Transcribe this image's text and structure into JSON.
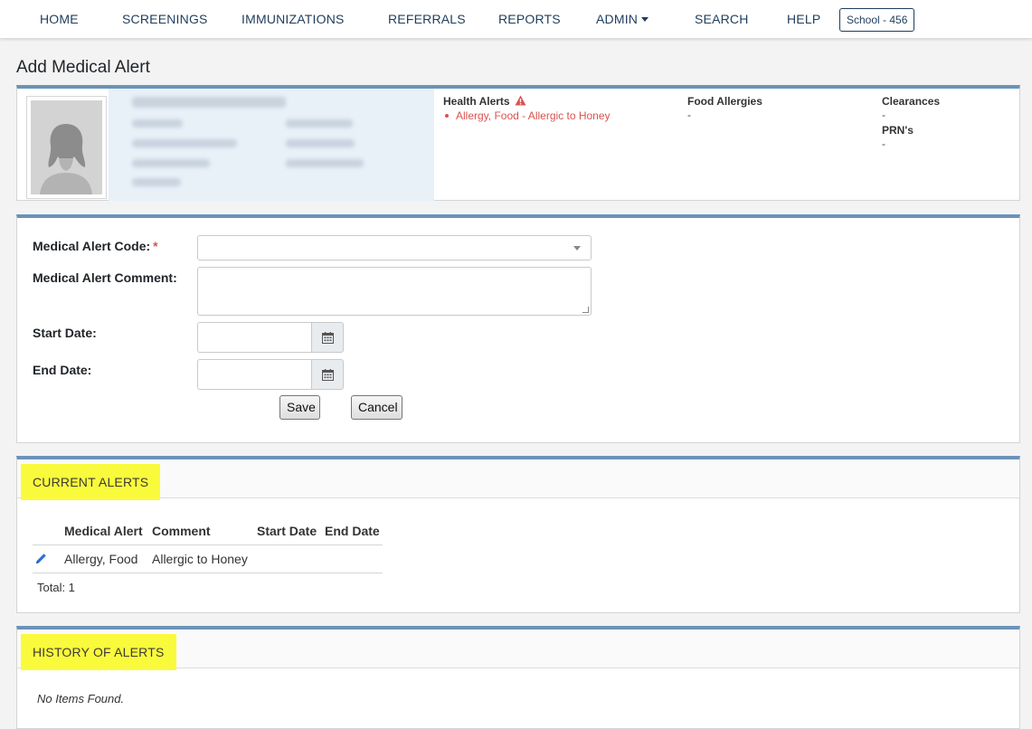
{
  "nav": {
    "items": [
      "HOME",
      "SCREENINGS",
      "IMMUNIZATIONS",
      "REFERRALS",
      "REPORTS",
      "ADMIN",
      "SEARCH",
      "HELP"
    ],
    "school_badge": "School - 456"
  },
  "page_title": "Add Medical Alert",
  "student": {
    "health_alerts_heading": "Health Alerts",
    "health_alert_item": "Allergy, Food - Allergic to Honey",
    "food_allergies_heading": "Food Allergies",
    "food_allergies_value": "-",
    "clearances_heading": "Clearances",
    "clearances_value": "-",
    "prns_heading": "PRN's",
    "prns_value": "-"
  },
  "form": {
    "code_label": "Medical Alert Code:",
    "required_mark": "*",
    "comment_label": "Medical Alert Comment:",
    "start_label": "Start Date:",
    "end_label": "End Date:",
    "save_label": "Save",
    "cancel_label": "Cancel"
  },
  "current_alerts": {
    "heading": "CURRENT ALERTS",
    "columns": [
      "Medical Alert",
      "Comment",
      "Start Date",
      "End Date"
    ],
    "rows": [
      {
        "alert": "Allergy, Food",
        "comment": "Allergic to Honey",
        "start": "",
        "end": ""
      }
    ],
    "total": "Total: 1"
  },
  "history": {
    "heading": "HISTORY OF ALERTS",
    "empty": "No Items Found."
  },
  "colors": {
    "nav_text": "#1f3d5c",
    "accent_border": "#6b93b8",
    "alert_red": "#d9534f",
    "highlight": "#fafa3c"
  },
  "icons": [
    "user-photo-placeholder",
    "warning-triangle-icon",
    "calendar-icon",
    "pencil-edit-icon"
  ]
}
